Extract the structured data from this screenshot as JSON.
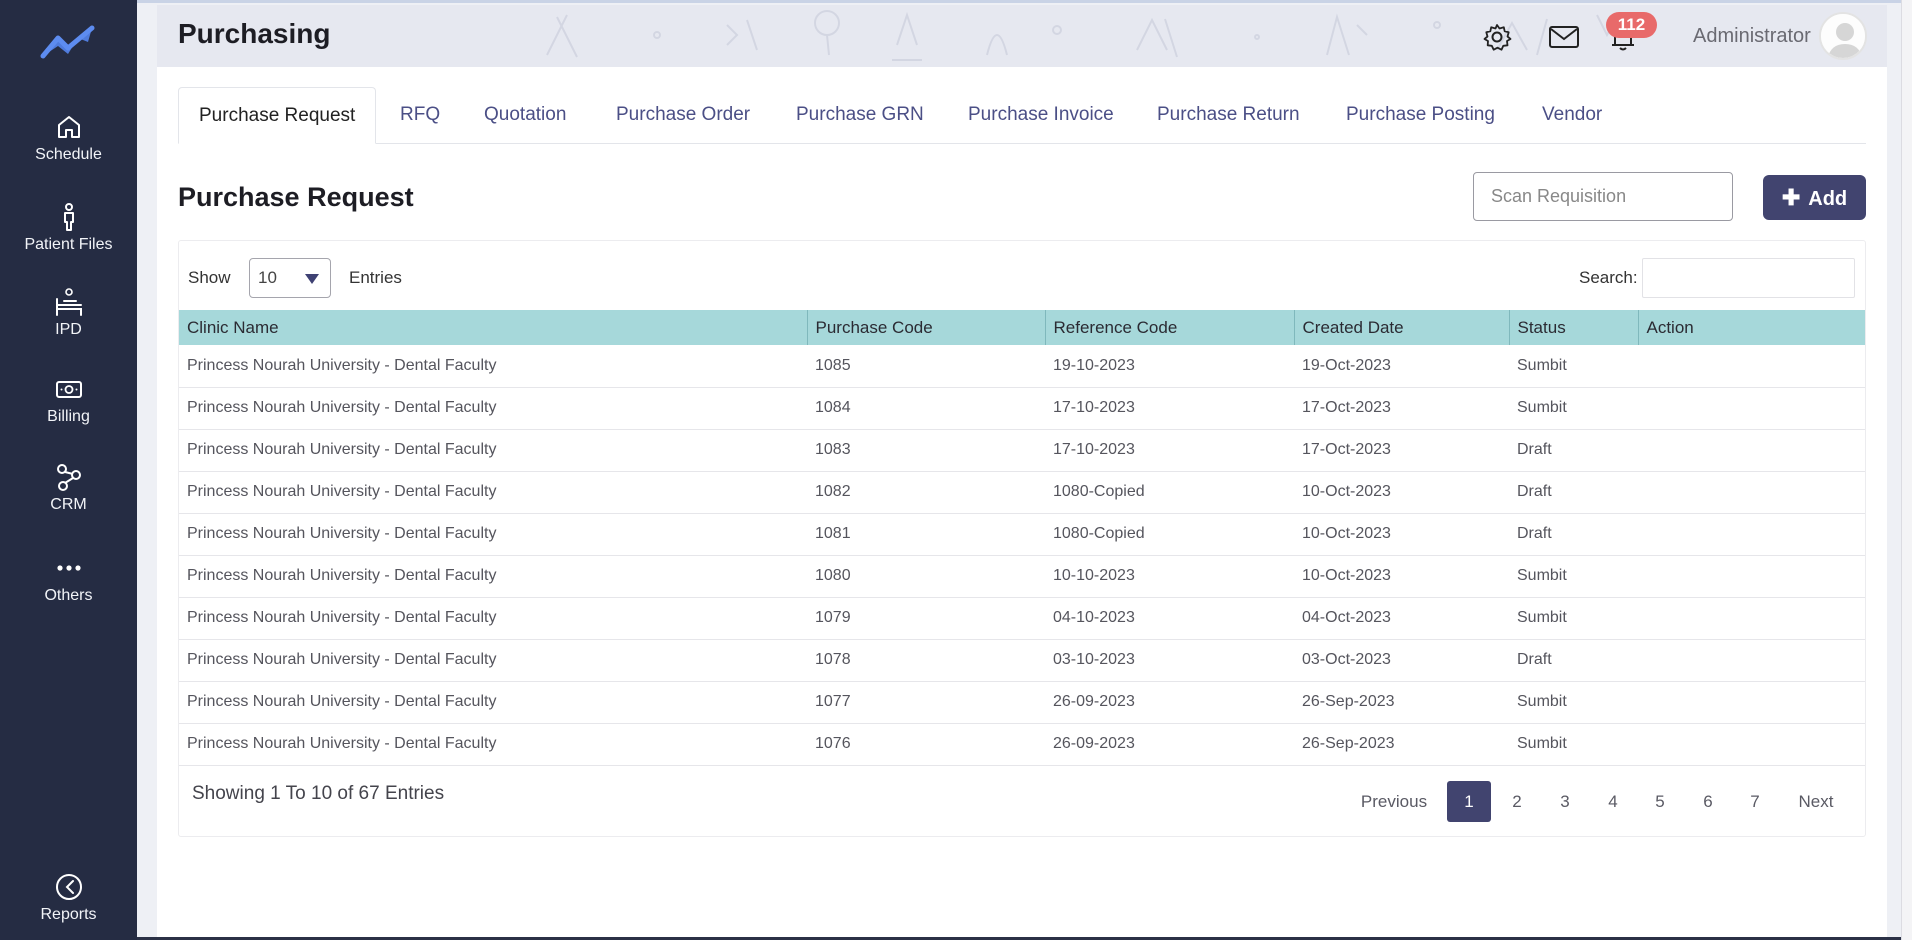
{
  "app": {
    "title": "Purchasing",
    "user": "Administrator",
    "notification_count": "112"
  },
  "sidebar": {
    "items": [
      {
        "label": "Schedule",
        "icon": "home-icon"
      },
      {
        "label": "Patient Files",
        "icon": "person-icon"
      },
      {
        "label": "IPD",
        "icon": "bed-icon"
      },
      {
        "label": "Billing",
        "icon": "money-icon"
      },
      {
        "label": "CRM",
        "icon": "network-icon"
      },
      {
        "label": "Others",
        "icon": "more-icon"
      },
      {
        "label": "Reports",
        "icon": "reports-icon"
      }
    ]
  },
  "tabs": [
    "Purchase Request",
    "RFQ",
    "Quotation",
    "Purchase Order",
    "Purchase GRN",
    "Purchase Invoice",
    "Purchase Return",
    "Purchase Posting",
    "Vendor"
  ],
  "active_tab": "Purchase Request",
  "page": {
    "title": "Purchase Request",
    "scan_placeholder": "Scan Requisition",
    "add_label": "Add"
  },
  "table_controls": {
    "show_label": "Show",
    "page_size": "10",
    "entries_label": "Entries",
    "search_label": "Search:"
  },
  "table": {
    "columns": [
      "Clinic Name",
      "Purchase Code",
      "Reference Code",
      "Created Date",
      "Status",
      "Action"
    ],
    "rows": [
      [
        "Princess Nourah University - Dental Faculty",
        "1085",
        "19-10-2023",
        "19-Oct-2023",
        "Sumbit",
        ""
      ],
      [
        "Princess Nourah University - Dental Faculty",
        "1084",
        "17-10-2023",
        "17-Oct-2023",
        "Sumbit",
        ""
      ],
      [
        "Princess Nourah University - Dental Faculty",
        "1083",
        "17-10-2023",
        "17-Oct-2023",
        "Draft",
        ""
      ],
      [
        "Princess Nourah University - Dental Faculty",
        "1082",
        "1080-Copied",
        "10-Oct-2023",
        "Draft",
        ""
      ],
      [
        "Princess Nourah University - Dental Faculty",
        "1081",
        "1080-Copied",
        "10-Oct-2023",
        "Draft",
        ""
      ],
      [
        "Princess Nourah University - Dental Faculty",
        "1080",
        "10-10-2023",
        "10-Oct-2023",
        "Sumbit",
        ""
      ],
      [
        "Princess Nourah University - Dental Faculty",
        "1079",
        "04-10-2023",
        "04-Oct-2023",
        "Sumbit",
        ""
      ],
      [
        "Princess Nourah University - Dental Faculty",
        "1078",
        "03-10-2023",
        "03-Oct-2023",
        "Draft",
        ""
      ],
      [
        "Princess Nourah University - Dental Faculty",
        "1077",
        "26-09-2023",
        "26-Sep-2023",
        "Sumbit",
        ""
      ],
      [
        "Princess Nourah University - Dental Faculty",
        "1076",
        "26-09-2023",
        "26-Sep-2023",
        "Sumbit",
        ""
      ]
    ]
  },
  "footer": {
    "showing": "Showing 1 To 10 of 67 Entries",
    "previous": "Previous",
    "next": "Next",
    "pages": [
      "1",
      "2",
      "3",
      "4",
      "5",
      "6",
      "7"
    ],
    "current_page": "1"
  },
  "colors": {
    "sidebar": "#252c43",
    "accent": "#41446f",
    "table_header": "#a6d8da",
    "badge": "#e86a6a",
    "logo": "#4f7bdc"
  }
}
